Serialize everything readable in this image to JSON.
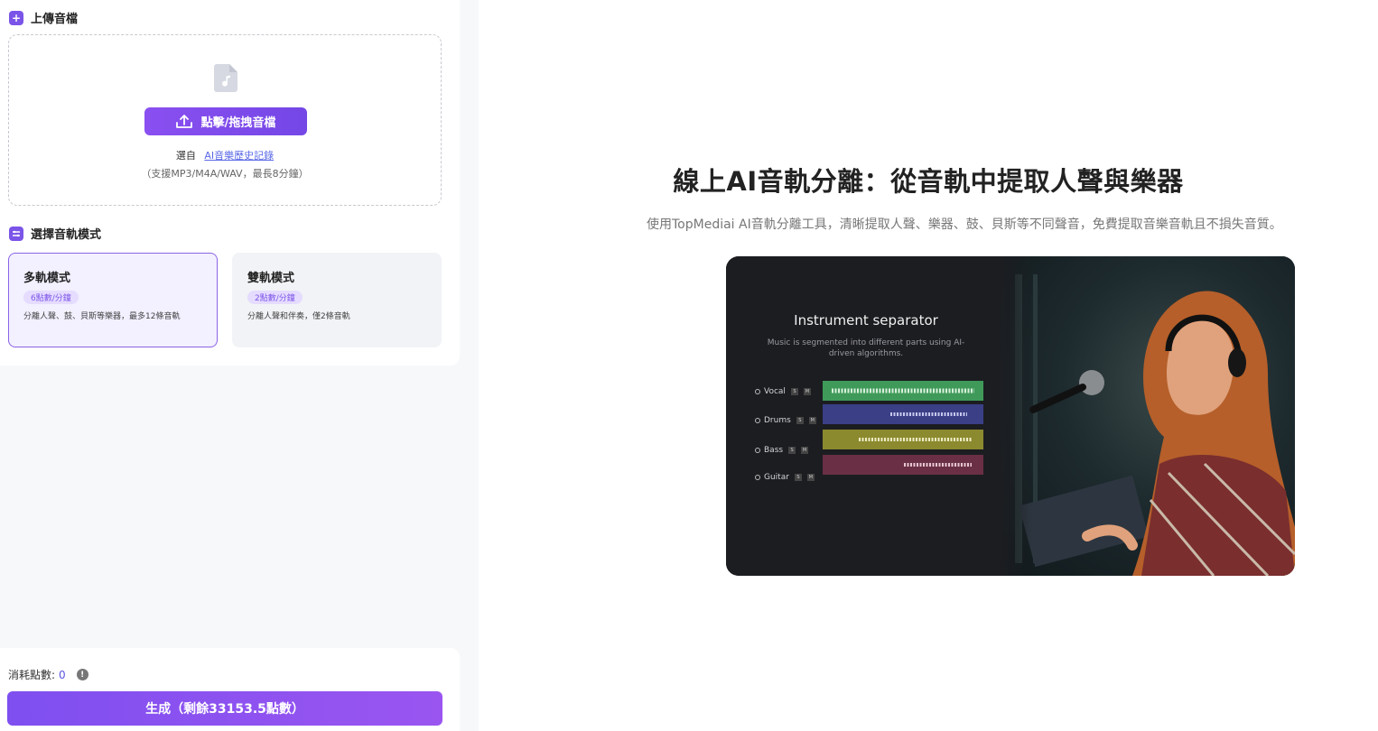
{
  "upload": {
    "title": "上傳音檔",
    "button_label": "點擊/拖拽音檔",
    "choose_prefix": "選自",
    "history_link": "AI音樂歷史記錄",
    "support_note": "（支援MP3/M4A/WAV，最長8分鐘）"
  },
  "mode": {
    "title": "選擇音軌模式",
    "options": [
      {
        "name": "多軌模式",
        "badge": "6點數/分鐘",
        "desc": "分離人聲、鼓、貝斯等樂器，最多12條音軌",
        "selected": true
      },
      {
        "name": "雙軌模式",
        "badge": "2點數/分鐘",
        "desc": "分離人聲和伴奏，僅2條音軌",
        "selected": false
      }
    ]
  },
  "footer": {
    "cost_label": "消耗點數:",
    "cost_value": "0",
    "generate_label": "生成（剩餘33153.5點數）"
  },
  "hero": {
    "title": "線上AI音軌分離：從音軌中提取人聲與樂器",
    "subtitle": "使用TopMediai AI音軌分離工具，清晰提取人聲、樂器、鼓、貝斯等不同聲音，免費提取音樂音軌且不損失音質。",
    "image": {
      "title": "Instrument separator",
      "desc": "Music is segmented into different parts using AI-driven algorithms.",
      "tracks": [
        {
          "name": "Vocal",
          "color": "#3f9a5a"
        },
        {
          "name": "Drums",
          "color": "#3a3f86"
        },
        {
          "name": "Bass",
          "color": "#8c8a2e"
        },
        {
          "name": "Guitar",
          "color": "#6a2f45"
        }
      ]
    }
  },
  "colors": {
    "accent": "#7b54e8",
    "link": "#5a68e6"
  }
}
